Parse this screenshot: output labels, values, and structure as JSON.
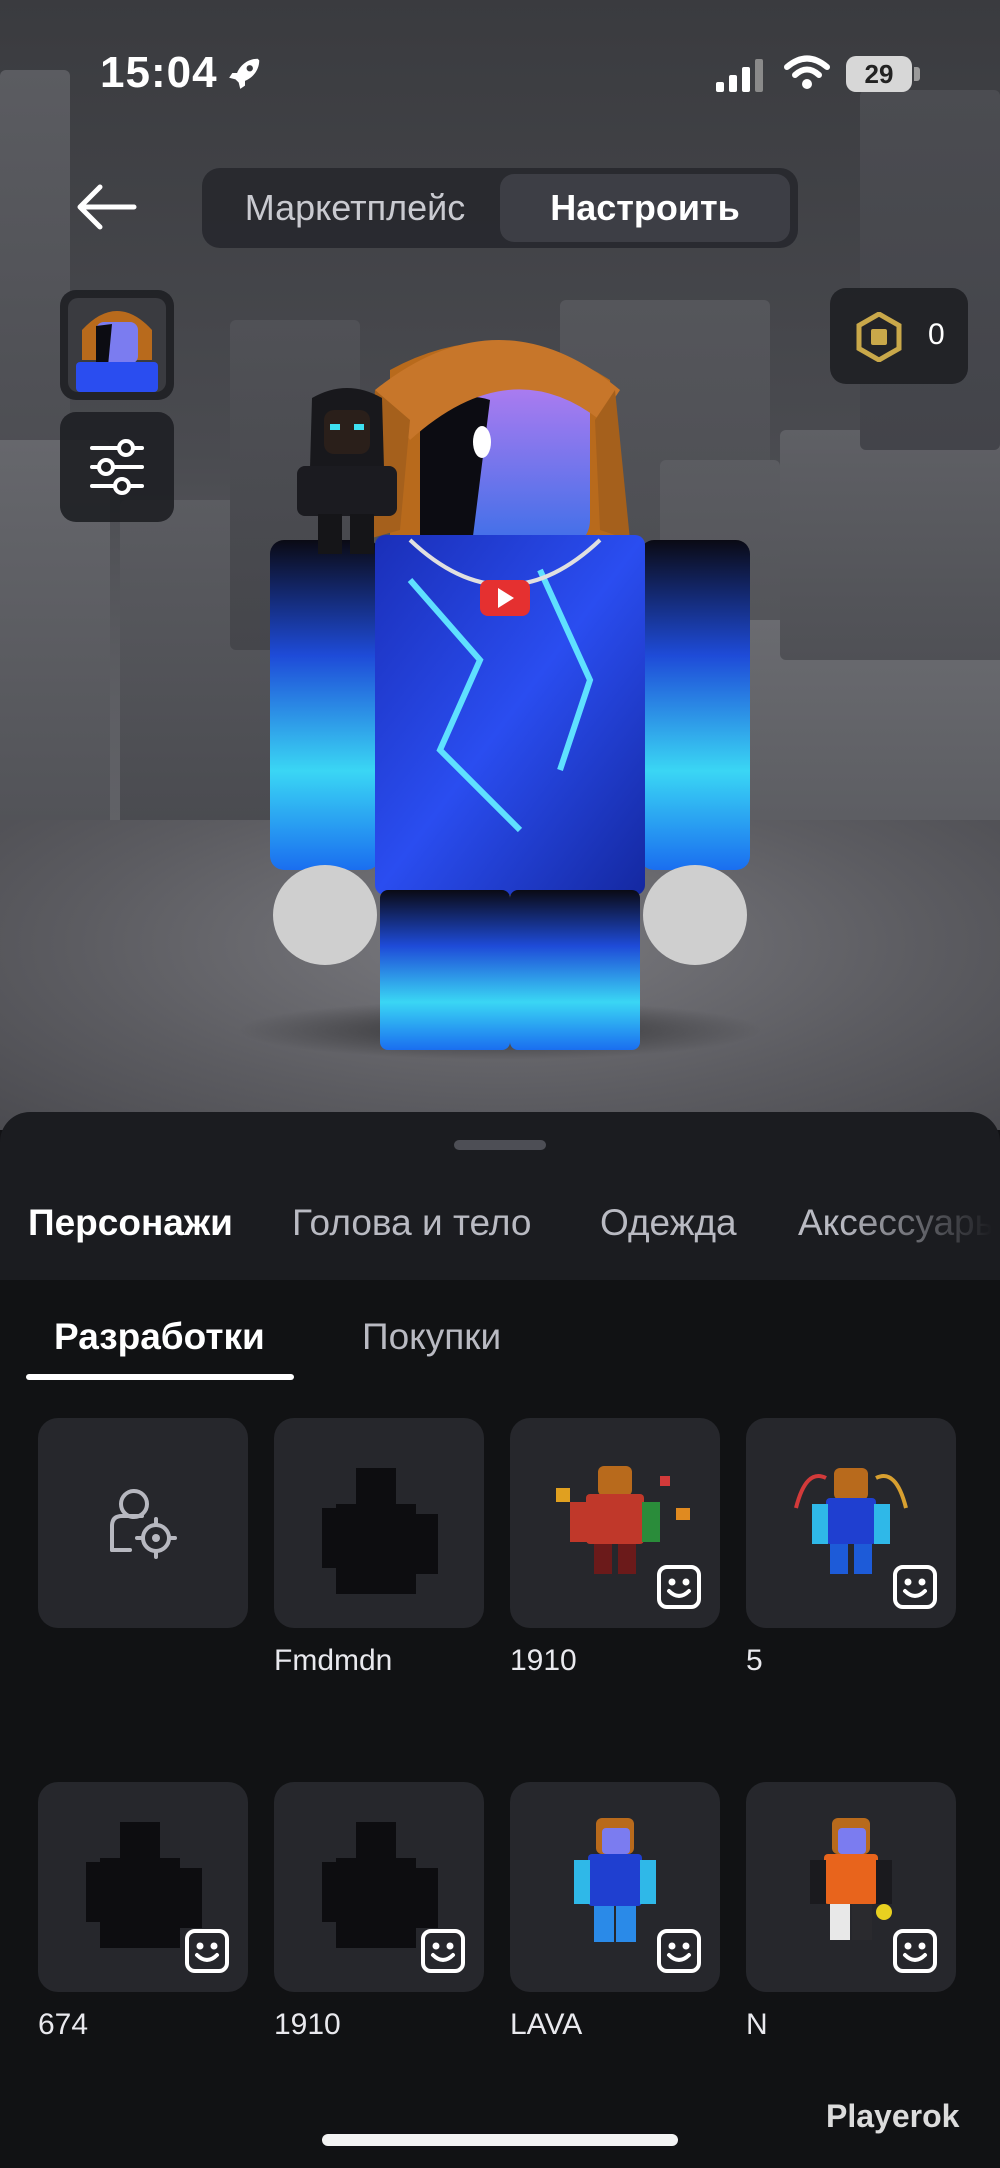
{
  "status_bar": {
    "time": "15:04",
    "battery": "29"
  },
  "top_nav": {
    "segments": [
      {
        "label": "Маркетплейс",
        "selected": false
      },
      {
        "label": "Настроить",
        "selected": true
      }
    ]
  },
  "robux": {
    "balance": "0"
  },
  "categories": [
    {
      "label": "Персонажи",
      "active": true
    },
    {
      "label": "Голова и тело",
      "active": false
    },
    {
      "label": "Одежда",
      "active": false
    },
    {
      "label": "Аксессуары",
      "active": false
    }
  ],
  "subtabs": [
    {
      "label": "Разработки",
      "active": true
    },
    {
      "label": "Покупки",
      "active": false
    }
  ],
  "characters": [
    {
      "name": "",
      "kind": "create"
    },
    {
      "name": "Fmdmdn",
      "kind": "silhouette"
    },
    {
      "name": "1910",
      "kind": "avatar"
    },
    {
      "name": "5",
      "kind": "avatar"
    },
    {
      "name": "674",
      "kind": "silhouette"
    },
    {
      "name": "1910",
      "kind": "silhouette"
    },
    {
      "name": "LAVA",
      "kind": "avatar"
    },
    {
      "name": "N",
      "kind": "avatar"
    }
  ],
  "watermark": "Playerok",
  "colors": {
    "accent_gold": "#c9a84a",
    "sheet_bg": "#1b1c20",
    "card_bg": "#26272c"
  }
}
